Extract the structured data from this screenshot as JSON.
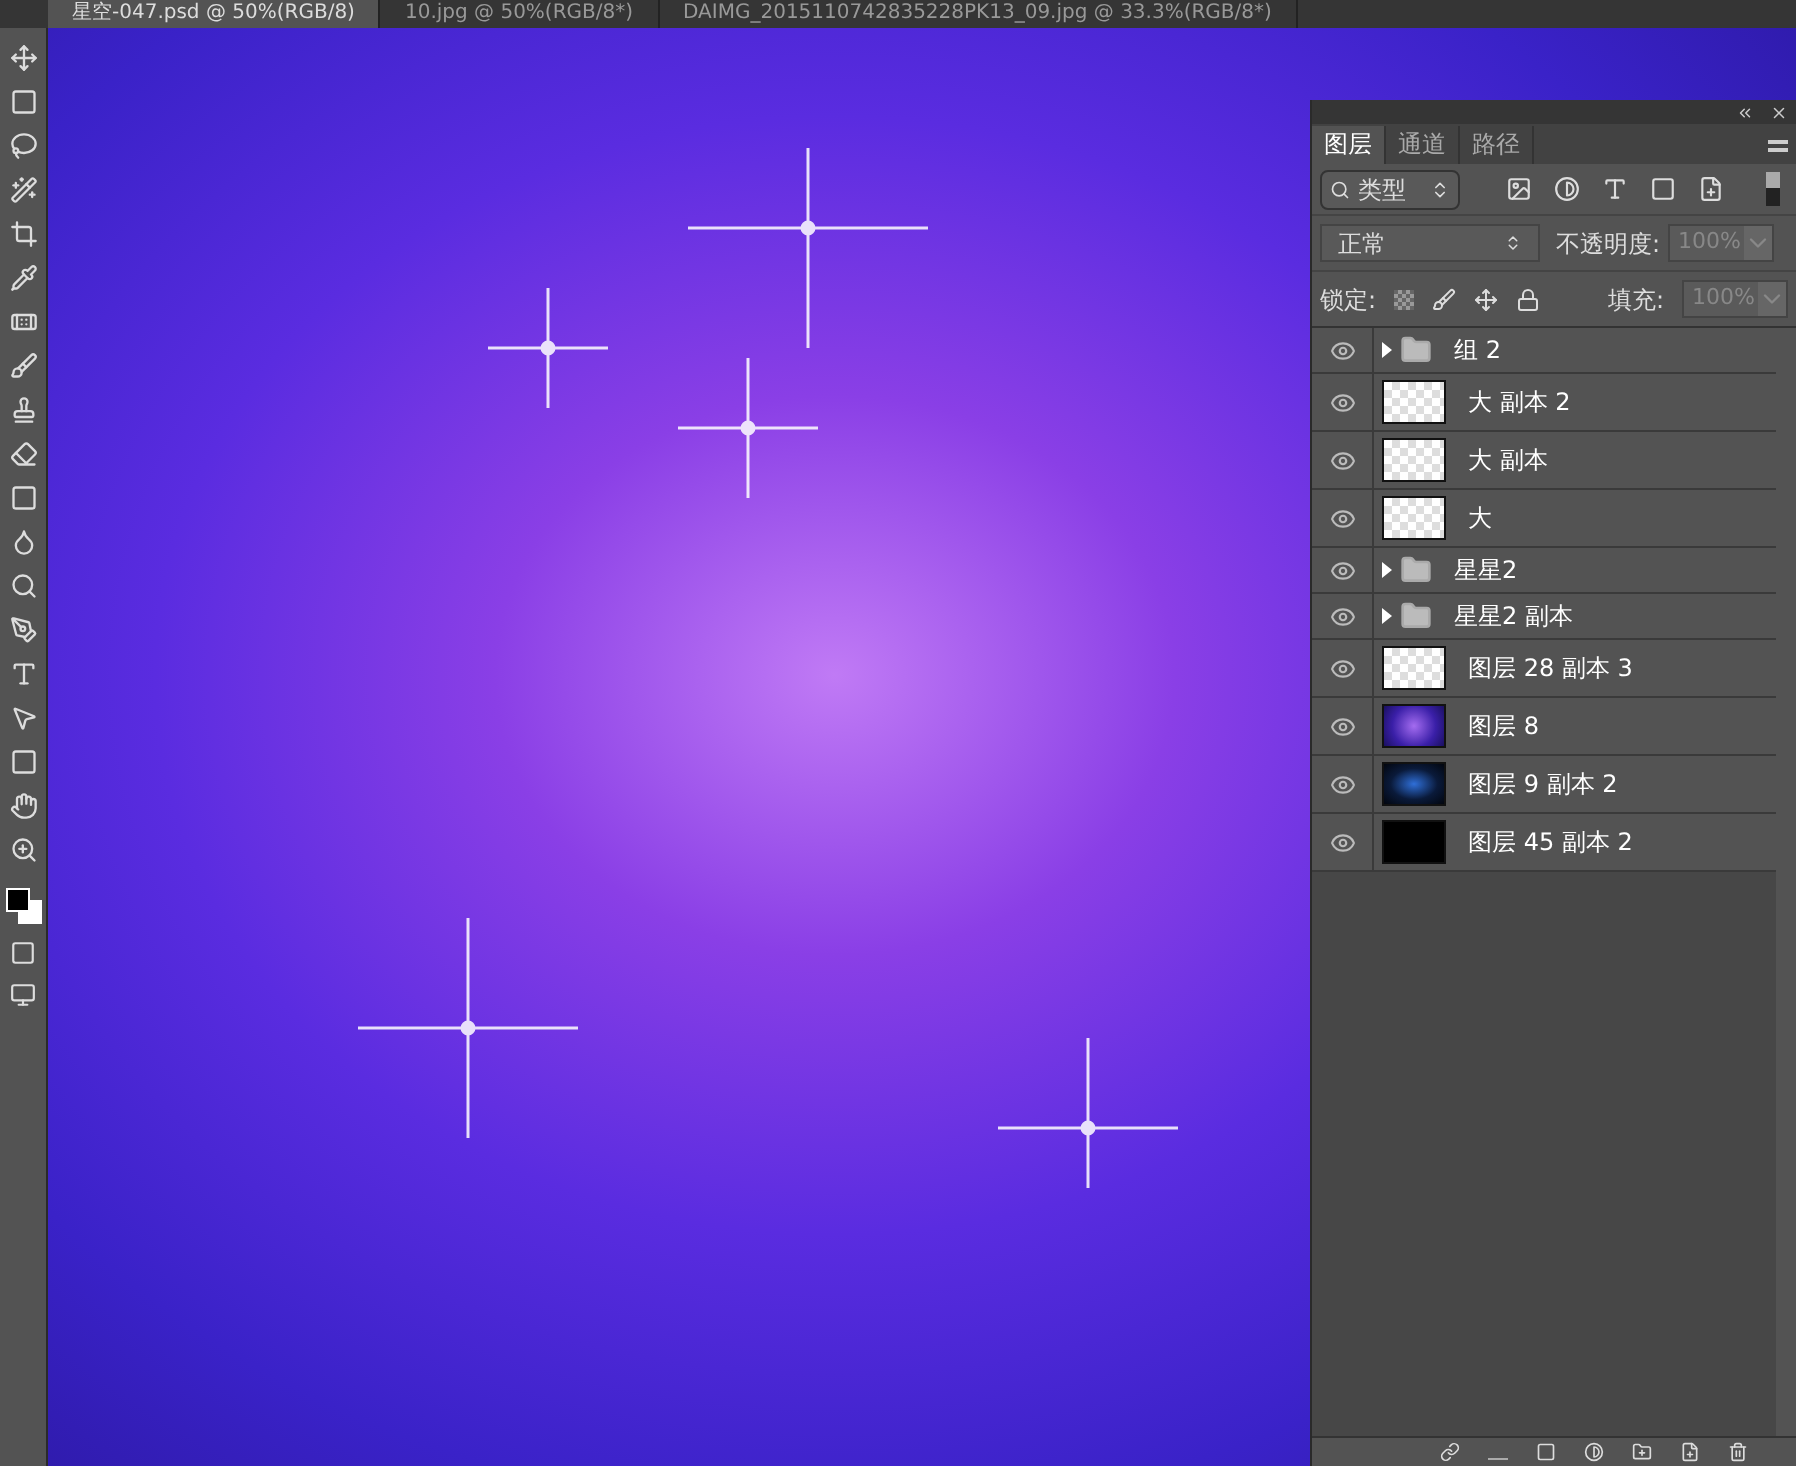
{
  "document_tabs": [
    {
      "title": "星空-047.psd @ 50%(RGB/8)",
      "selected": true
    },
    {
      "title": "10.jpg @ 50%(RGB/8*)",
      "selected": false
    },
    {
      "title": "DAIMG_2015110742835228PK13_09.jpg @ 33.3%(RGB/8*)",
      "selected": false
    }
  ],
  "layers_panel": {
    "tabs": [
      {
        "label": "图层",
        "selected": true
      },
      {
        "label": "通道",
        "selected": false
      },
      {
        "label": "路径",
        "selected": false
      }
    ],
    "filter": {
      "value": "类型"
    },
    "blend_mode": {
      "value": "正常"
    },
    "opacity": {
      "label": "不透明度:",
      "value": "100%"
    },
    "lock": {
      "label": "锁定:"
    },
    "fill": {
      "label": "填充:",
      "value": "100%"
    },
    "layers": [
      {
        "name": "组 2",
        "kind": "group",
        "visible": true
      },
      {
        "name": "大 副本 2",
        "kind": "transparent",
        "visible": true
      },
      {
        "name": "大 副本",
        "kind": "transparent",
        "visible": true
      },
      {
        "name": "大",
        "kind": "transparent",
        "visible": true
      },
      {
        "name": "星星2",
        "kind": "group",
        "visible": true
      },
      {
        "name": "星星2 副本",
        "kind": "group",
        "visible": true
      },
      {
        "name": "图层 28 副本 3",
        "kind": "transparent",
        "visible": true
      },
      {
        "name": "图层 8",
        "kind": "galaxy",
        "visible": true
      },
      {
        "name": "图层 9 副本 2",
        "kind": "stars",
        "visible": true
      },
      {
        "name": "图层 45 副本 2",
        "kind": "black",
        "visible": true
      }
    ]
  }
}
